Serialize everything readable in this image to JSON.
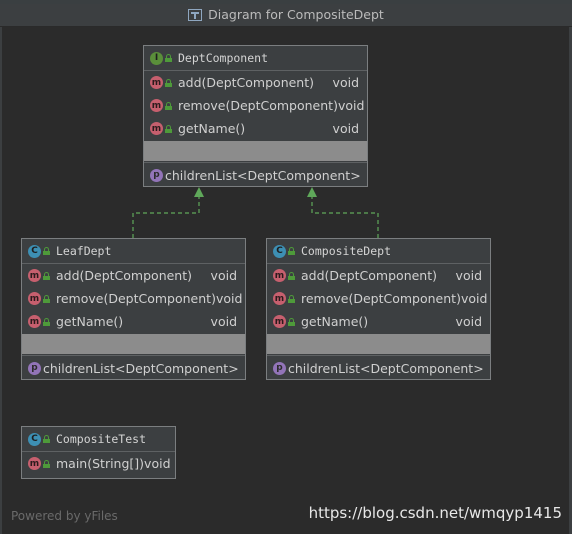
{
  "window": {
    "title": "Diagram for CompositeDept",
    "footer": "Powered by yFiles"
  },
  "watermark": "https://blog.csdn.net/wmqyp1415",
  "nodes": {
    "dept_component": {
      "badge": "I",
      "name": "DeptComponent",
      "methods": [
        {
          "badge": "m",
          "name": "add(DeptComponent)",
          "type": "void"
        },
        {
          "badge": "m",
          "name": "remove(DeptComponent)",
          "type": "void"
        },
        {
          "badge": "m",
          "name": "getName()",
          "type": "void"
        }
      ],
      "field": {
        "badge": "p",
        "name": "children",
        "type": "List<DeptComponent>"
      }
    },
    "leaf_dept": {
      "badge": "C",
      "name": "LeafDept",
      "methods": [
        {
          "badge": "m",
          "name": "add(DeptComponent)",
          "type": "void"
        },
        {
          "badge": "m",
          "name": "remove(DeptComponent)",
          "type": "void"
        },
        {
          "badge": "m",
          "name": "getName()",
          "type": "void"
        }
      ],
      "field": {
        "badge": "p",
        "name": "children",
        "type": "List<DeptComponent>"
      }
    },
    "composite_dept": {
      "badge": "C",
      "name": "CompositeDept",
      "methods": [
        {
          "badge": "m",
          "name": "add(DeptComponent)",
          "type": "void"
        },
        {
          "badge": "m",
          "name": "remove(DeptComponent)",
          "type": "void"
        },
        {
          "badge": "m",
          "name": "getName()",
          "type": "void"
        }
      ],
      "field": {
        "badge": "p",
        "name": "children",
        "type": "List<DeptComponent>"
      }
    },
    "composite_test": {
      "badge": "C",
      "name": "CompositeTest",
      "methods": [
        {
          "badge": "m",
          "name": "main(String[])",
          "type": "void"
        }
      ]
    }
  },
  "colors": {
    "edge": "#5fa85a",
    "canvas": "#2b2b2b",
    "node": "#3c3f41"
  }
}
